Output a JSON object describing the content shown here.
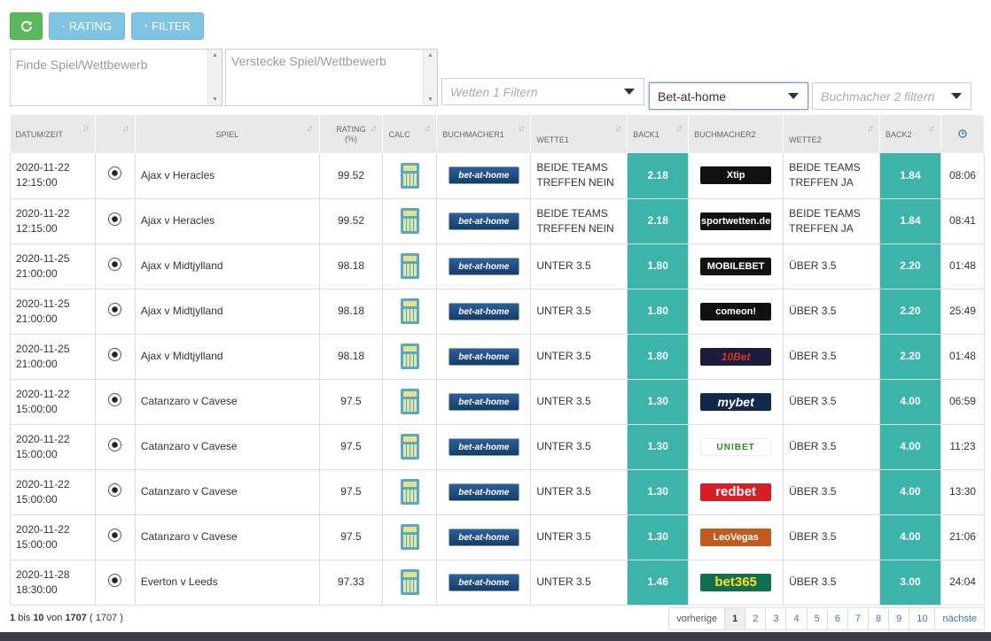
{
  "toolbar": {
    "rating_label": "RATING",
    "filter_label": "FILTER"
  },
  "filters": {
    "find_placeholder": "Finde Spiel/Wettbewerb",
    "hide_placeholder": "Verstecke Spiel/Wettbewerb",
    "bet1_placeholder": "Wetten 1 Filtern",
    "bookmaker1_value": "Bet-at-home",
    "bookmaker2_placeholder": "Buchmacher 2 filtern"
  },
  "table": {
    "headers": {
      "datum": "DATUM/ZEIT",
      "spiel": "SPIEL",
      "rating": "RATING (%)",
      "calc": "CALC",
      "buchmacher1": "BUCHMACHER1",
      "wette1": "WETTE1",
      "back1": "BACK1",
      "buchmacher2": "BUCHMACHER2",
      "wette2": "WETTE2",
      "back2": "BACK2"
    },
    "rows": [
      {
        "date": "2020-11-22",
        "time": "12:15:00",
        "match": "Ajax v Heracles",
        "rating": "99.52",
        "bm1": "bet-at-home",
        "w1a": "BEIDE TEAMS",
        "w1b": "TREFFEN NEIN",
        "back1": "2.18",
        "bm2": "Xtip",
        "w2a": "BEIDE TEAMS",
        "w2b": "TREFFEN JA",
        "back2": "1.84",
        "age": "08:06"
      },
      {
        "date": "2020-11-22",
        "time": "12:15:00",
        "match": "Ajax v Heracles",
        "rating": "99.52",
        "bm1": "bet-at-home",
        "w1a": "BEIDE TEAMS",
        "w1b": "TREFFEN NEIN",
        "back1": "2.18",
        "bm2": "sportwetten.de",
        "w2a": "BEIDE TEAMS",
        "w2b": "TREFFEN JA",
        "back2": "1.84",
        "age": "08:41"
      },
      {
        "date": "2020-11-25",
        "time": "21:00:00",
        "match": "Ajax v Midtjylland",
        "rating": "98.18",
        "bm1": "bet-at-home",
        "w1a": "UNTER 3.5",
        "w1b": "",
        "back1": "1.80",
        "bm2": "MOBILEBET",
        "w2a": "ÜBER 3.5",
        "w2b": "",
        "back2": "2.20",
        "age": "01:48"
      },
      {
        "date": "2020-11-25",
        "time": "21:00:00",
        "match": "Ajax v Midtjylland",
        "rating": "98.18",
        "bm1": "bet-at-home",
        "w1a": "UNTER 3.5",
        "w1b": "",
        "back1": "1.80",
        "bm2": "comeon!",
        "w2a": "ÜBER 3.5",
        "w2b": "",
        "back2": "2.20",
        "age": "25:49"
      },
      {
        "date": "2020-11-25",
        "time": "21:00:00",
        "match": "Ajax v Midtjylland",
        "rating": "98.18",
        "bm1": "bet-at-home",
        "w1a": "UNTER 3.5",
        "w1b": "",
        "back1": "1.80",
        "bm2": "10Bet",
        "w2a": "ÜBER 3.5",
        "w2b": "",
        "back2": "2.20",
        "age": "01:48"
      },
      {
        "date": "2020-11-22",
        "time": "15:00:00",
        "match": "Catanzaro v Cavese",
        "rating": "97.5",
        "bm1": "bet-at-home",
        "w1a": "UNTER 3.5",
        "w1b": "",
        "back1": "1.30",
        "bm2": "mybet",
        "w2a": "ÜBER 3.5",
        "w2b": "",
        "back2": "4.00",
        "age": "06:59"
      },
      {
        "date": "2020-11-22",
        "time": "15:00:00",
        "match": "Catanzaro v Cavese",
        "rating": "97.5",
        "bm1": "bet-at-home",
        "w1a": "UNTER 3.5",
        "w1b": "",
        "back1": "1.30",
        "bm2": "UNIBET",
        "w2a": "ÜBER 3.5",
        "w2b": "",
        "back2": "4.00",
        "age": "11:23"
      },
      {
        "date": "2020-11-22",
        "time": "15:00:00",
        "match": "Catanzaro v Cavese",
        "rating": "97.5",
        "bm1": "bet-at-home",
        "w1a": "UNTER 3.5",
        "w1b": "",
        "back1": "1.30",
        "bm2": "redbet",
        "w2a": "ÜBER 3.5",
        "w2b": "",
        "back2": "4.00",
        "age": "13:30"
      },
      {
        "date": "2020-11-22",
        "time": "15:00:00",
        "match": "Catanzaro v Cavese",
        "rating": "97.5",
        "bm1": "bet-at-home",
        "w1a": "UNTER 3.5",
        "w1b": "",
        "back1": "1.30",
        "bm2": "LeoVegas",
        "w2a": "ÜBER 3.5",
        "w2b": "",
        "back2": "4.00",
        "age": "21:06"
      },
      {
        "date": "2020-11-28",
        "time": "18:30:00",
        "match": "Everton v Leeds",
        "rating": "97.33",
        "bm1": "bet-at-home",
        "w1a": "UNTER 3.5",
        "w1b": "",
        "back1": "1.46",
        "bm2": "bet365",
        "w2a": "ÜBER 3.5",
        "w2b": "",
        "back2": "3.00",
        "age": "24:04"
      }
    ]
  },
  "footer": {
    "from": "1",
    "bis": "bis",
    "to": "10",
    "von": "von",
    "total": "1707",
    "filtered": "( 1707 )"
  },
  "pager": {
    "prev": "vorherige",
    "next": "nächste",
    "pages": [
      "1",
      "2",
      "3",
      "4",
      "5",
      "6",
      "7",
      "8",
      "9",
      "10"
    ]
  },
  "colors": {
    "back_cell": "#3cb4aa",
    "refresh_button": "#5cb85c",
    "info_button": "#7fc4e3"
  },
  "icons": {
    "refresh": "refresh-icon",
    "rating": "cogs-icon",
    "filter": "filter-icon",
    "sport": "soccer-ball-icon",
    "calc": "calculator-icon",
    "age": "clock-icon"
  }
}
